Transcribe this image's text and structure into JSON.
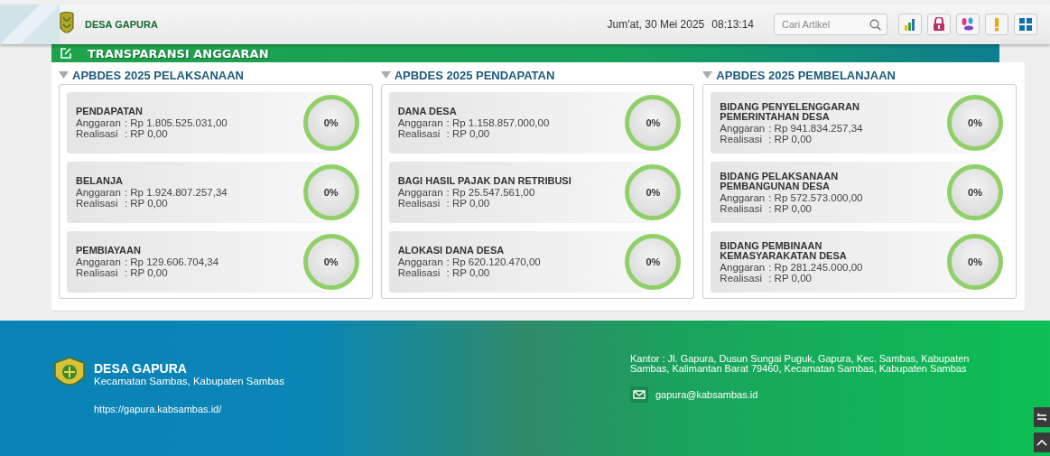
{
  "header": {
    "site_name": "DESA GAPURA",
    "date": "Jum'at, 30 Mei 2025",
    "time": "08:13:14",
    "search": {
      "placeholder": "Cari Artikel"
    },
    "toolbar": [
      {
        "kind": "chart"
      },
      {
        "kind": "lock"
      },
      {
        "kind": "petals"
      },
      {
        "kind": "alert"
      },
      {
        "kind": "grid"
      }
    ]
  },
  "banner": {
    "title": "TRANSPARANSI ANGGARAN"
  },
  "sections": [
    {
      "title": "APBDES 2025 PELAKSANAAN",
      "items": [
        {
          "title": "PENDAPATAN",
          "rows": [
            {
              "label": "Anggaran",
              "value": ": Rp 1.805.525.031,00"
            },
            {
              "label": "Realisasi",
              "value": ": RP 0,00"
            }
          ],
          "percent": "0%"
        },
        {
          "title": "BELANJA",
          "rows": [
            {
              "label": "Anggaran",
              "value": ": Rp 1.924.807.257,34"
            },
            {
              "label": "Realisasi",
              "value": ": RP 0,00"
            }
          ],
          "percent": "0%"
        },
        {
          "title": "PEMBIAYAAN",
          "rows": [
            {
              "label": "Anggaran",
              "value": ": Rp 129.606.704,34"
            },
            {
              "label": "Realisasi",
              "value": ": RP 0,00"
            }
          ],
          "percent": "0%"
        }
      ]
    },
    {
      "title": "APBDES 2025 PENDAPATAN",
      "items": [
        {
          "title": "DANA DESA",
          "rows": [
            {
              "label": "Anggaran",
              "value": ": Rp 1.158.857.000,00"
            },
            {
              "label": "Realisasi",
              "value": ": RP 0,00"
            }
          ],
          "percent": "0%"
        },
        {
          "title": "BAGI HASIL PAJAK DAN RETRIBUSI",
          "rows": [
            {
              "label": "Anggaran",
              "value": ": Rp 25.547.561,00"
            },
            {
              "label": "Realisasi",
              "value": ": RP 0,00"
            }
          ],
          "percent": "0%"
        },
        {
          "title": "ALOKASI DANA DESA",
          "rows": [
            {
              "label": "Anggaran",
              "value": ": Rp 620.120.470,00"
            },
            {
              "label": "Realisasi",
              "value": ": RP 0,00"
            }
          ],
          "percent": "0%"
        }
      ]
    },
    {
      "title": "APBDES 2025 PEMBELANJAAN",
      "items": [
        {
          "title": "BIDANG PENYELENGGARAN PEMERINTAHAN DESA",
          "rows": [
            {
              "label": "Anggaran",
              "value": ": Rp 941.834.257,34"
            },
            {
              "label": "Realisasi",
              "value": ": RP 0,00"
            }
          ],
          "percent": "0%"
        },
        {
          "title": "BIDANG PELAKSANAAN PEMBANGUNAN DESA",
          "rows": [
            {
              "label": "Anggaran",
              "value": ": Rp 572.573.000,00"
            },
            {
              "label": "Realisasi",
              "value": ": RP 0,00"
            }
          ],
          "percent": "0%"
        },
        {
          "title": "BIDANG PEMBINAAN KEMASYARAKATAN DESA",
          "rows": [
            {
              "label": "Anggaran",
              "value": ": Rp 281.245.000,00"
            },
            {
              "label": "Realisasi",
              "value": ": RP 0,00"
            }
          ],
          "percent": "0%"
        }
      ]
    }
  ],
  "footer": {
    "name": "DESA GAPURA",
    "subtitle": "Kecamatan Sambas, Kabupaten Sambas",
    "url": "https://gapura.kabsambas.id/",
    "address": "Kantor : Jl. Gapura, Dusun Sungai Puguk, Gapura, Kec. Sambas, Kabupaten Sambas, Kalimantan Barat 79460, Kecamatan Sambas, Kabupaten Sambas",
    "email": "gapura@kabsambas.id"
  }
}
